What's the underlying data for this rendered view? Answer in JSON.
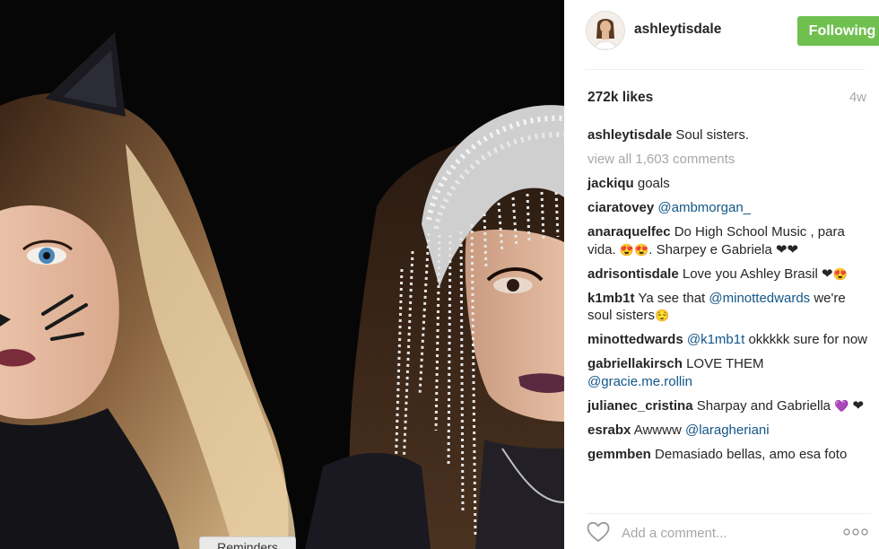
{
  "post": {
    "author": "ashleytisdale",
    "follow_label": "Following",
    "likes": "272k likes",
    "age": "4w",
    "caption": "Soul sisters.",
    "view_all": "view all 1,603 comments",
    "add_comment_placeholder": "Add a comment...",
    "comments": [
      {
        "user": "jackiqu",
        "text": "goals"
      },
      {
        "user": "ciaratovey",
        "mention": "@ambmorgan_"
      },
      {
        "user": "anaraquelfec",
        "text": "Do High School Music , para vida.",
        "emoji": "😍😍",
        "text2": ". Sharpey e Gabriela",
        "hearts": "❤❤"
      },
      {
        "user": "adrisontisdale",
        "text": "Love you Ashley Brasil",
        "hearts": "❤",
        "emoji": "😍"
      },
      {
        "user": "k1mb1t",
        "text": "Ya see that",
        "mention": "@minottedwards",
        "text2": "we're soul sisters",
        "emoji": "😌"
      },
      {
        "user": "minottedwards",
        "mention": "@k1mb1t",
        "text": "okkkkk sure for now"
      },
      {
        "user": "gabriellakirsch",
        "text": "LOVE THEM",
        "mention": "@gracie.me.rollin"
      },
      {
        "user": "julianec_cristina",
        "text": "Sharpay and Gabriella",
        "emoji": "💜",
        "hearts": "❤"
      },
      {
        "user": "esrabx",
        "text": "Awwww",
        "mention": "@laragheriani"
      },
      {
        "user": "gemmben",
        "text": "Demasiado bellas, amo esa foto"
      }
    ]
  },
  "overlay": {
    "reminders_label": "Reminders"
  },
  "colors": {
    "follow_bg": "#70c050",
    "mention": "#125688",
    "muted": "#a5a7aa",
    "text": "#262626"
  },
  "icons": [
    "heart-outline-icon",
    "more-options-icon"
  ]
}
